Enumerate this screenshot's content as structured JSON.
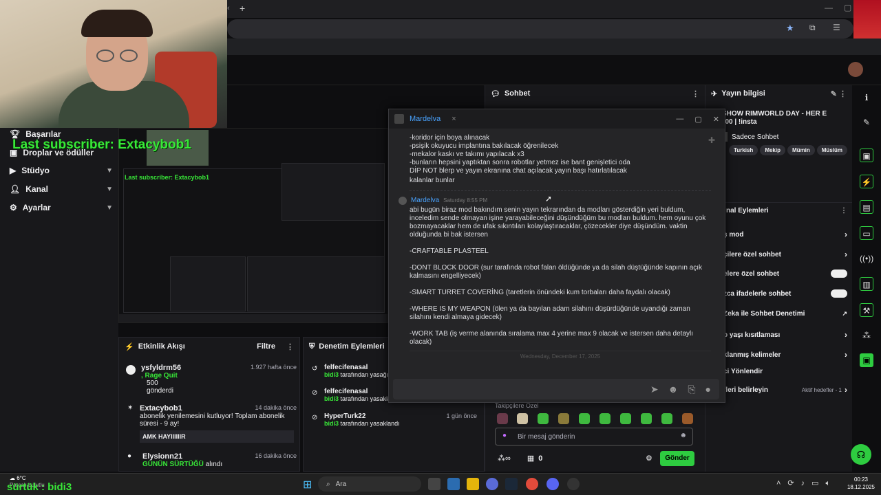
{
  "overlay": {
    "last_subscriber": "Last subscriber: Extacybob1",
    "bottom_text": "sürtük : bidi3",
    "mini_subscriber": "Last subscriber: Extacybob1"
  },
  "nav": [
    {
      "label": "Başarılar",
      "icon": "trophy-icon"
    },
    {
      "label": "Droplar ve ödüller",
      "icon": "gift-icon"
    },
    {
      "label": "Stüdyo",
      "icon": "video-icon",
      "chevron": true
    },
    {
      "label": "Kanal",
      "icon": "user-icon",
      "chevron": true
    },
    {
      "label": "Ayarlar",
      "icon": "gear-icon",
      "chevron": true
    }
  ],
  "activity": {
    "title": "Etkinlik Akışı",
    "filter": "Filtre",
    "items": [
      {
        "name": "ysfyldrm56",
        "time": "1.927 hafta önce",
        "detail": ", Rage Quit",
        "amount": "500",
        "sub": "gönderdi"
      },
      {
        "name": "Extacybob1",
        "time": "14 dakika önce",
        "detail": "abonelik yenilemesini kutluyor! Toplam abonelik süresi - 9 ay!",
        "quote": "AMK HAYIIIIIIR"
      },
      {
        "name": "Elysionn21",
        "time": "16 dakika önce",
        "highlight": "GÜNÜN SÜRTÜĞÜ",
        "detail": "alındı"
      }
    ]
  },
  "moderation": {
    "title": "Denetim Eylemleri",
    "items": [
      {
        "name": "felfecifenasal",
        "mod": "bidi3",
        "action": "tarafından yasağı l"
      },
      {
        "name": "felfecifenasal",
        "mod": "bidi3",
        "action": "tarafından yasakla"
      },
      {
        "name": "HyperTurk22",
        "time": "1 gün önce",
        "mod": "bidi3",
        "action": "tarafından yasaklandı"
      }
    ]
  },
  "chatwin": {
    "title": "Mardelva",
    "lines_top": [
      "-koridor için boya alınacak",
      "-psişik okuyucu implantına bakılacak öğrenilecek",
      "-mekalor kaskı ve takımı yapılacak x3",
      "-bunların hepsini yaptıktan sonra robotlar yetmez ise bant genişletici oda",
      "DİP NOT blerp ve yayın ekranına chat açılacak yayın başı hatırlatılacak",
      "kalanlar bunlar"
    ],
    "author": "Mardelva",
    "time": "Saturday 8:55 PM",
    "message": "abi bugün biraz mod bakındım senin yayın tekrarından da modları gösterdiğin yeri buldum, inceledim sende olmayan işine yarayabileceğini düşündüğüm bu modları buldum. hem oyunu çok bozmayacaklar hem de ufak sıkıntıları kolaylaştıracaklar, çözecekler diye düşündüm. vaktin olduğunda bi bak istersen",
    "mods": [
      "-CRAFTABLE PLASTEEL",
      "-DONT BLOCK DOOR (sur tarafında robot falan öldüğünde ya da silah düştüğünde kapının açık kalmasını engelliyecek)",
      "-SMART TURRET COVERİNG (taretlerin önündeki kum torbaları daha faydalı olacak)",
      "-WHERE IS MY WEAPON (ölen ya da bayılan adam silahını düşürdüğünde uyandığı zaman silahını kendi almaya gidecek)",
      "-WORK TAB (iş verme alanında sıralama max 4 yerine max 9 olacak ve istersen daha detaylı olacak)"
    ],
    "date_divider": "Wednesday, December 17, 2025"
  },
  "chat": {
    "title": "Sohbet",
    "followers_label": "Takipçilere Özel",
    "input_placeholder": "Bir mesaj gönderin",
    "points": "0",
    "send": "Gönder"
  },
  "info": {
    "title": "Yayın bilgisi",
    "stream_title": "R SHOW RIMWORLD DAY - HER E 00:00 | !insta",
    "category": "Sadece Sohbet",
    "tags": [
      "Turkish",
      "Mekip",
      "Mümin",
      "Müslüm"
    ],
    "actions_title": "nal Eylemleri",
    "rows": [
      {
        "label": "ş mod",
        "control": "chevron"
      },
      {
        "label": "çilere özel sohbet",
        "control": "chevron"
      },
      {
        "label": "elere özel sohbet",
        "control": "toggle"
      },
      {
        "label": "zca ifadelerle sohbet",
        "control": "toggle"
      },
      {
        "label": "Zeka ile Sohbet Denetimi",
        "control": "external"
      },
      {
        "label": "p yaşı kısıtlaması",
        "control": "chevron"
      },
      {
        "label": "klanmış kelimeler",
        "control": "chevron"
      },
      {
        "label": "ci Yönlendir",
        "control": "none"
      },
      {
        "label": "fleri belirleyin",
        "control": "chevron",
        "extra": "Aktif hedefler - 1"
      }
    ]
  },
  "taskbar": {
    "weather_temp": "6°C",
    "weather_text": "Parçalı bulutlu",
    "search": "Ara",
    "time": "00:23",
    "date": "18.12.2025"
  },
  "colors": {
    "accent_green": "#38e838",
    "twitch_bg": "#18181b",
    "send_button": "#2ecc40",
    "link_blue": "#49a3ff"
  }
}
